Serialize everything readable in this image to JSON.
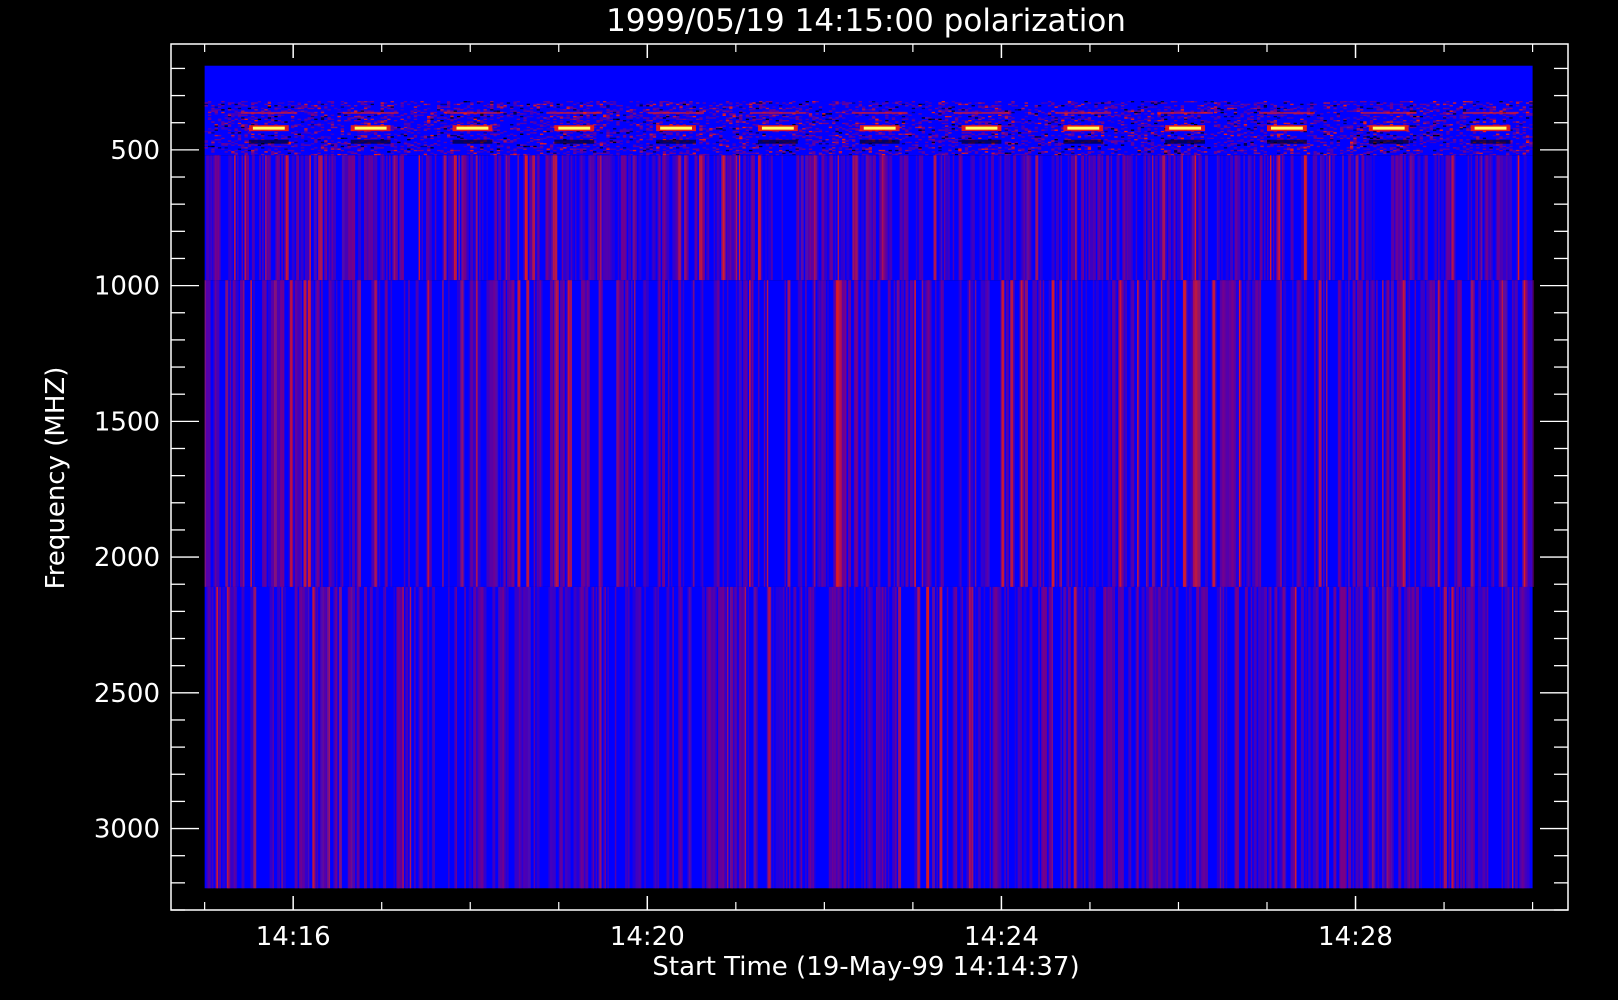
{
  "chart_data": {
    "type": "heatmap",
    "title": "1999/05/19 14:15:00 polarization",
    "xlabel": "Start Time (19-May-99 14:14:37)",
    "ylabel": "Frequency (MHZ)",
    "x_range_minutes": [
      14.62,
      30.4
    ],
    "x_major_ticks": [
      {
        "minute": 16,
        "label": "14:16"
      },
      {
        "minute": 20,
        "label": "14:20"
      },
      {
        "minute": 24,
        "label": "14:24"
      },
      {
        "minute": 28,
        "label": "14:28"
      }
    ],
    "x_minor_tick_minutes": [
      15,
      17,
      18,
      19,
      21,
      22,
      23,
      25,
      26,
      27,
      29,
      30
    ],
    "ylim": [
      3300,
      110
    ],
    "y_reversed": true,
    "y_major_ticks": [
      500,
      1000,
      1500,
      2000,
      2500,
      3000
    ],
    "y_minor_tick_step": 100,
    "data_extent": {
      "time_minutes": [
        15.0,
        30.0
      ],
      "frequency_mhz": [
        190,
        3220
      ]
    },
    "bands_mhz": [
      {
        "from": 190,
        "to": 320,
        "pattern": "uniform"
      },
      {
        "from": 320,
        "to": 520,
        "pattern": "bursts"
      },
      {
        "from": 520,
        "to": 980,
        "pattern": "striped"
      },
      {
        "from": 980,
        "to": 2110,
        "pattern": "striped"
      },
      {
        "from": 2110,
        "to": 3220,
        "pattern": "striped"
      }
    ],
    "colors": {
      "background": "#000000",
      "base": "#0000ff",
      "mid": "#800080",
      "high": "#ff2000",
      "peak": "#ffff60",
      "axes": "#ffffff"
    }
  }
}
